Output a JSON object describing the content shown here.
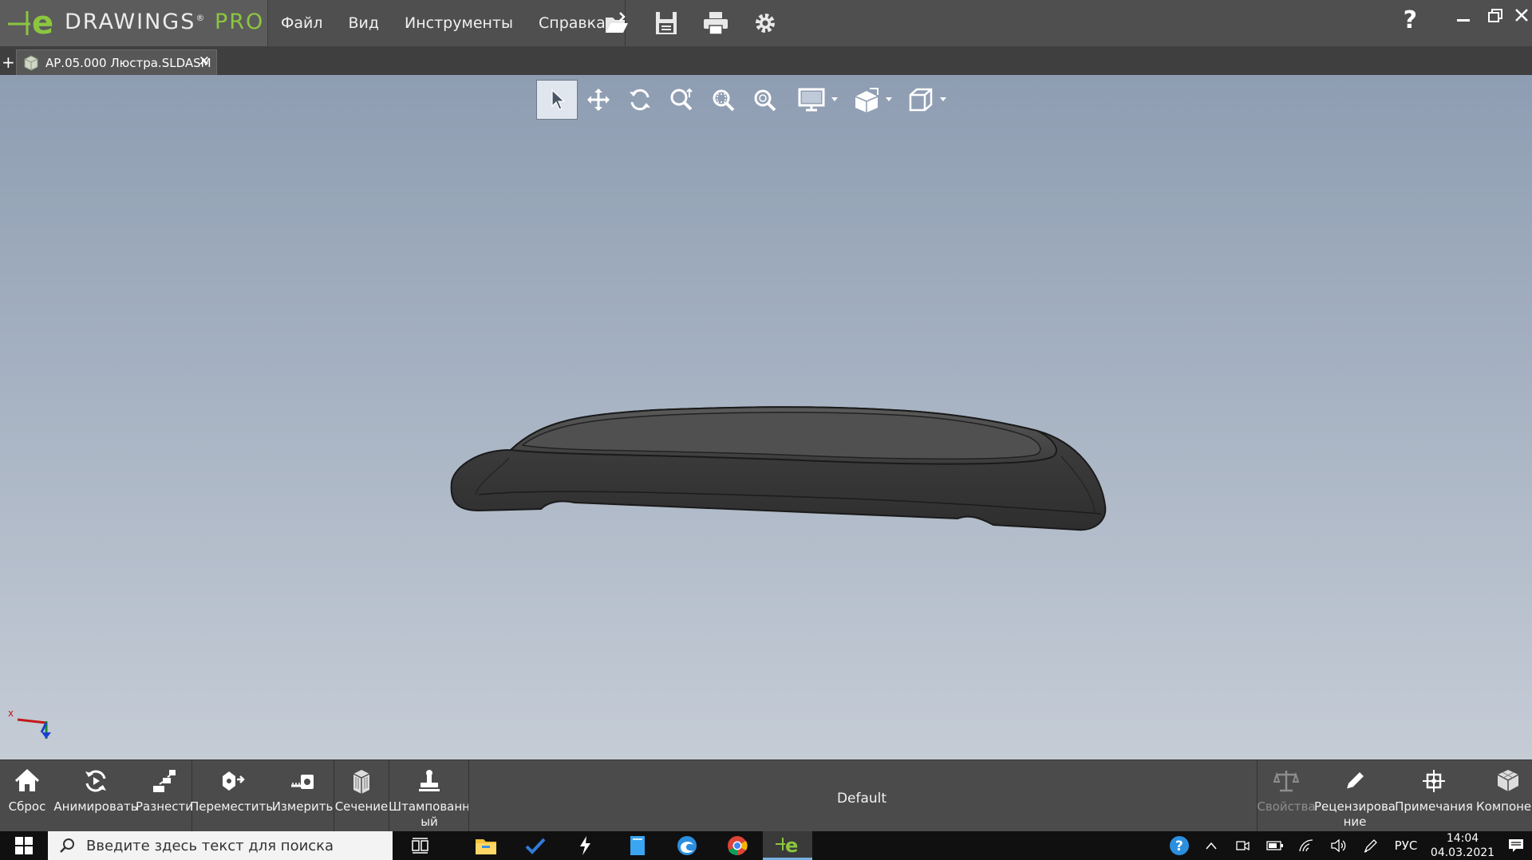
{
  "app": {
    "brand_main": "DRAWINGS",
    "brand_suffix": "PRO",
    "registered": "®"
  },
  "menu": [
    "Файл",
    "Вид",
    "Инструменты",
    "Справка"
  ],
  "quick_icons": [
    "open-icon",
    "save-icon",
    "print-icon",
    "gear-icon"
  ],
  "window_controls": {
    "help": "?"
  },
  "tab": {
    "label": "АР.05.000 Люстра.SLDASM",
    "close": "✕",
    "add": "+"
  },
  "view_tools": [
    "select-icon",
    "pan-icon",
    "rotate-icon",
    "zoom-icon",
    "zoom-area-icon",
    "zoom-fit-icon",
    "display-icon",
    "render-style-icon",
    "view-orientation-icon"
  ],
  "triad": {
    "x_label": "x"
  },
  "bottom_tools_left": [
    {
      "label": "Сброс",
      "icon": "home-icon"
    },
    {
      "label": "Анимировать",
      "icon": "animate-icon"
    },
    {
      "label": "Разнести",
      "icon": "explode-icon"
    },
    {
      "label": "Переместить",
      "icon": "move-icon"
    },
    {
      "label": "Измерить",
      "icon": "measure-icon"
    },
    {
      "label": "Сечение",
      "icon": "section-icon"
    },
    {
      "label": "Штампованн\nый",
      "icon": "stamp-icon"
    }
  ],
  "configuration": "Default",
  "bottom_tools_right": [
    {
      "label": "Свойства",
      "icon": "scales-icon",
      "disabled": true
    },
    {
      "label": "Рецензирова\nние",
      "icon": "pencil-icon",
      "disabled": false
    },
    {
      "label": "Примечания",
      "icon": "notes-icon",
      "disabled": false
    },
    {
      "label": "Компонен",
      "icon": "components-icon",
      "disabled": false
    }
  ],
  "taskbar": {
    "search_placeholder": "Введите здесь текст для поиска",
    "apps": [
      "task-view-icon",
      "file-explorer-icon",
      "todo-icon",
      "app-icon",
      "notepad-icon",
      "edge-icon",
      "chrome-icon",
      "edrawings-icon"
    ],
    "language": "РУС",
    "time": "14:04",
    "date": "04.03.2021"
  },
  "colors": {
    "accent_green": "#8cc63f",
    "menubar": "#4f4f4f",
    "viewport_top": "#8e9db2",
    "viewport_bottom": "#c5ccd6"
  }
}
